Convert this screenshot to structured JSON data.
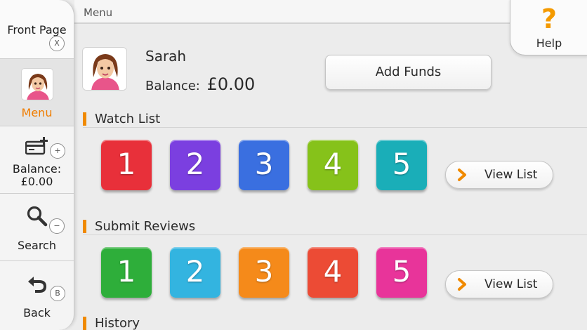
{
  "topbar": {
    "crumb": "Menu"
  },
  "help": {
    "icon": "?",
    "label": "Help"
  },
  "sidebar": {
    "front_page": {
      "label": "Front Page",
      "badge": "X"
    },
    "menu": {
      "label": "Menu"
    },
    "balance": {
      "label": "Balance:",
      "value": "£0.00",
      "badge": "+"
    },
    "search": {
      "label": "Search",
      "badge": "−"
    },
    "back": {
      "label": "Back",
      "badge": "B"
    }
  },
  "profile": {
    "name": "Sarah",
    "balance_label": "Balance:",
    "balance_value": "£0.00",
    "add_funds_label": "Add Funds"
  },
  "watch_list": {
    "title": "Watch List",
    "items": [
      {
        "label": "1",
        "color": "#e8303a"
      },
      {
        "label": "2",
        "color": "#7b3fe0"
      },
      {
        "label": "3",
        "color": "#3a6fe0"
      },
      {
        "label": "4",
        "color": "#86c21a"
      },
      {
        "label": "5",
        "color": "#1aaeb8"
      }
    ],
    "view_label": "View List"
  },
  "submit_reviews": {
    "title": "Submit Reviews",
    "items": [
      {
        "label": "1",
        "color": "#2eae3a"
      },
      {
        "label": "2",
        "color": "#33b4e0"
      },
      {
        "label": "3",
        "color": "#f58a1a"
      },
      {
        "label": "4",
        "color": "#ec4b35"
      },
      {
        "label": "5",
        "color": "#e8349a"
      }
    ],
    "view_label": "View List"
  },
  "history": {
    "title": "History"
  },
  "colors": {
    "accent": "#f08a00",
    "menu_active": "#f07d00"
  }
}
